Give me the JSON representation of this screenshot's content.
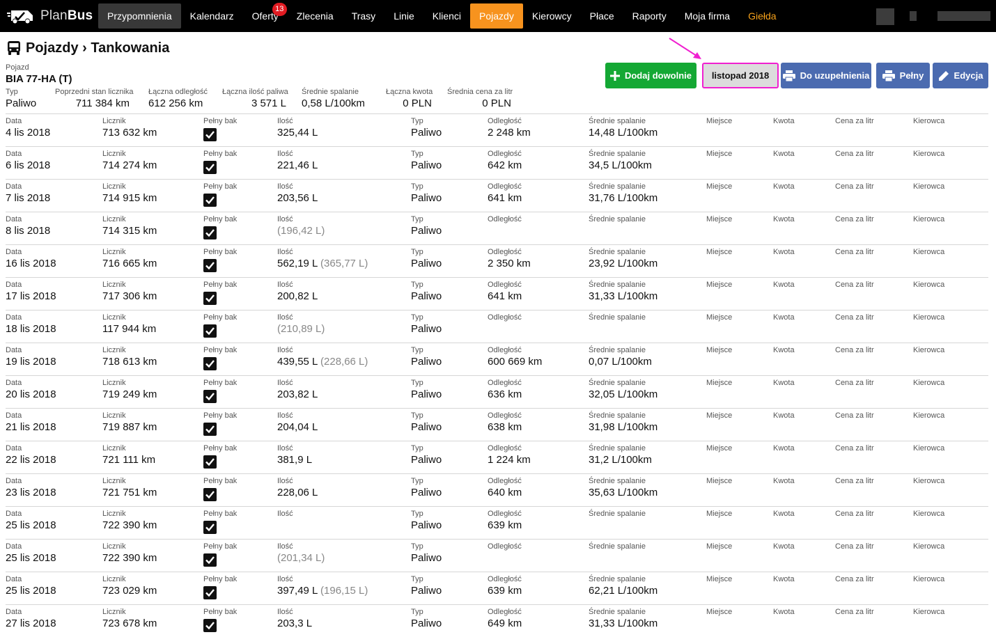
{
  "app": {
    "logo_plan": "Plan",
    "logo_bus": "Bus"
  },
  "nav": [
    {
      "label": "Przypomnienia",
      "state": "active"
    },
    {
      "label": "Kalendarz"
    },
    {
      "label": "Oferty",
      "badge": "13"
    },
    {
      "label": "Zlecenia"
    },
    {
      "label": "Trasy"
    },
    {
      "label": "Linie"
    },
    {
      "label": "Klienci"
    },
    {
      "label": "Pojazdy",
      "state": "current"
    },
    {
      "label": "Kierowcy"
    },
    {
      "label": "Płace"
    },
    {
      "label": "Raporty"
    },
    {
      "label": "Moja firma"
    },
    {
      "label": "Giełda",
      "state": "highlight"
    }
  ],
  "header": {
    "breadcrumb": "Pojazdy › Tankowania",
    "vehicle_label": "Pojazd",
    "vehicle_value": "BIA 77-HA (T)"
  },
  "summary": [
    {
      "label": "Typ",
      "value": "Paliwo"
    },
    {
      "label": "Poprzedni stan licznika",
      "value": "711 384 km"
    },
    {
      "label": "Łączna odległość",
      "value": "612 256 km"
    },
    {
      "label": "Łączna ilość paliwa",
      "value": "3 571 L"
    },
    {
      "label": "Średnie spalanie",
      "value": "0,58 L/100km"
    },
    {
      "label": "Łączna kwota",
      "value": "0 PLN"
    },
    {
      "label": "Średnia cena za litr",
      "value": "0 PLN"
    }
  ],
  "toolbar": {
    "add_label": "Dodaj dowolnie",
    "month_label": "listopad 2018",
    "fill_label": "Do uzupełnienia",
    "full_label": "Pełny",
    "edit_label": "Edycja"
  },
  "columns": {
    "date": "Data",
    "odometer": "Licznik",
    "full_tank": "Pełny bak",
    "amount": "Ilość",
    "type": "Typ",
    "distance": "Odległość",
    "avg": "Średnie spalanie",
    "place": "Miejsce",
    "cost": "Kwota",
    "price": "Cena za litr",
    "driver": "Kierowca"
  },
  "rows": [
    {
      "date": "4 lis 2018",
      "odometer": "713 632 km",
      "full": true,
      "amount": "325,44 L",
      "amount_extra": "",
      "type": "Paliwo",
      "distance": "2 248 km",
      "avg": "14,48 L/100km"
    },
    {
      "date": "6 lis 2018",
      "odometer": "714 274 km",
      "full": true,
      "amount": "221,46 L",
      "amount_extra": "",
      "type": "Paliwo",
      "distance": "642 km",
      "avg": "34,5 L/100km"
    },
    {
      "date": "7 lis 2018",
      "odometer": "714 915 km",
      "full": true,
      "amount": "203,56 L",
      "amount_extra": "",
      "type": "Paliwo",
      "distance": "641 km",
      "avg": "31,76 L/100km"
    },
    {
      "date": "8 lis 2018",
      "odometer": "714 315 km",
      "full": true,
      "amount": "",
      "amount_extra": "(196,42 L)",
      "type": "Paliwo",
      "distance": "",
      "avg": ""
    },
    {
      "date": "16 lis 2018",
      "odometer": "716 665 km",
      "full": true,
      "amount": "562,19 L",
      "amount_extra": "(365,77 L)",
      "type": "Paliwo",
      "distance": "2 350 km",
      "avg": "23,92 L/100km"
    },
    {
      "date": "17 lis 2018",
      "odometer": "717 306 km",
      "full": true,
      "amount": "200,82 L",
      "amount_extra": "",
      "type": "Paliwo",
      "distance": "641 km",
      "avg": "31,33 L/100km"
    },
    {
      "date": "18 lis 2018",
      "odometer": "117 944 km",
      "full": true,
      "amount": "",
      "amount_extra": "(210,89 L)",
      "type": "Paliwo",
      "distance": "",
      "avg": ""
    },
    {
      "date": "19 lis 2018",
      "odometer": "718 613 km",
      "full": true,
      "amount": "439,55 L",
      "amount_extra": "(228,66 L)",
      "type": "Paliwo",
      "distance": "600 669 km",
      "avg": "0,07 L/100km"
    },
    {
      "date": "20 lis 2018",
      "odometer": "719 249 km",
      "full": true,
      "amount": "203,82 L",
      "amount_extra": "",
      "type": "Paliwo",
      "distance": "636 km",
      "avg": "32,05 L/100km"
    },
    {
      "date": "21 lis 2018",
      "odometer": "719 887 km",
      "full": true,
      "amount": "204,04 L",
      "amount_extra": "",
      "type": "Paliwo",
      "distance": "638 km",
      "avg": "31,98 L/100km"
    },
    {
      "date": "22 lis 2018",
      "odometer": "721 111 km",
      "full": true,
      "amount": "381,9 L",
      "amount_extra": "",
      "type": "Paliwo",
      "distance": "1 224 km",
      "avg": "31,2 L/100km"
    },
    {
      "date": "23 lis 2018",
      "odometer": "721 751 km",
      "full": true,
      "amount": "228,06 L",
      "amount_extra": "",
      "type": "Paliwo",
      "distance": "640 km",
      "avg": "35,63 L/100km"
    },
    {
      "date": "25 lis 2018",
      "odometer": "722 390 km",
      "full": true,
      "amount": "",
      "amount_extra": "",
      "type": "Paliwo",
      "distance": "639 km",
      "avg": ""
    },
    {
      "date": "25 lis 2018",
      "odometer": "722 390 km",
      "full": true,
      "amount": "",
      "amount_extra": "(201,34 L)",
      "type": "Paliwo",
      "distance": "",
      "avg": ""
    },
    {
      "date": "25 lis 2018",
      "odometer": "723 029 km",
      "full": true,
      "amount": "397,49 L",
      "amount_extra": "(196,15 L)",
      "type": "Paliwo",
      "distance": "639 km",
      "avg": "62,21 L/100km"
    },
    {
      "date": "27 lis 2018",
      "odometer": "723 678 km",
      "full": true,
      "amount": "203,3 L",
      "amount_extra": "",
      "type": "Paliwo",
      "distance": "649 km",
      "avg": "31,33 L/100km"
    }
  ],
  "colors": {
    "topbar": "#000000",
    "active_tab": "#f7931e",
    "gold": "#f7a21b",
    "badge": "#e11b22",
    "add_button": "#14a834",
    "blue_button": "#4b6bb0",
    "annotation": "#f020d0"
  }
}
